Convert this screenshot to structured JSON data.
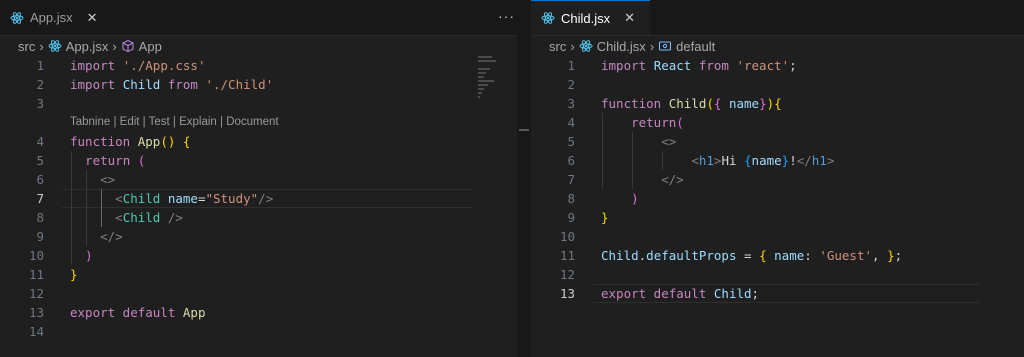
{
  "left_editor": {
    "tab": {
      "filename": "App.jsx",
      "icon": "react-icon",
      "close_icon": "close-icon"
    },
    "more_actions": "···",
    "breadcrumb": {
      "folder": "src",
      "file": "App.jsx",
      "symbol": "App"
    },
    "codelens": "Tabnine | Edit | Test | Explain | Document",
    "current_line": 7
  },
  "right_editor": {
    "tab": {
      "filename": "Child.jsx",
      "icon": "react-icon",
      "close_icon": "close-icon"
    },
    "breadcrumb": {
      "folder": "src",
      "file": "Child.jsx",
      "symbol": "default"
    },
    "current_line": 13
  },
  "left_code": [
    {
      "n": "1",
      "t": [
        [
          "kw",
          "import "
        ],
        [
          "str",
          "'./App.css'"
        ]
      ]
    },
    {
      "n": "2",
      "t": [
        [
          "kw",
          "import "
        ],
        [
          "var",
          "Child "
        ],
        [
          "kw",
          "from "
        ],
        [
          "str",
          "'./Child'"
        ]
      ]
    },
    {
      "n": "3",
      "t": []
    },
    {
      "n": "4",
      "t": [
        [
          "kw",
          "function "
        ],
        [
          "fn",
          "App"
        ],
        [
          "b1",
          "() {"
        ]
      ]
    },
    {
      "n": "5",
      "t": [
        [
          "plain",
          "  "
        ],
        [
          "kw",
          "return "
        ],
        [
          "b2",
          "("
        ]
      ]
    },
    {
      "n": "6",
      "t": [
        [
          "plain",
          "    "
        ],
        [
          "pun",
          "<>"
        ]
      ]
    },
    {
      "n": "7",
      "t": [
        [
          "plain",
          "      "
        ],
        [
          "pun",
          "<"
        ],
        [
          "cmp",
          "Child "
        ],
        [
          "var",
          "name"
        ],
        [
          "plain",
          "="
        ],
        [
          "str",
          "\"Study\""
        ],
        [
          "pun",
          "/>"
        ]
      ]
    },
    {
      "n": "8",
      "t": [
        [
          "plain",
          "      "
        ],
        [
          "pun",
          "<"
        ],
        [
          "cmp",
          "Child "
        ],
        [
          "pun",
          "/>"
        ]
      ]
    },
    {
      "n": "9",
      "t": [
        [
          "plain",
          "    "
        ],
        [
          "pun",
          "</>"
        ]
      ]
    },
    {
      "n": "10",
      "t": [
        [
          "plain",
          "  "
        ],
        [
          "b2",
          ")"
        ]
      ]
    },
    {
      "n": "11",
      "t": [
        [
          "b1",
          "}"
        ]
      ]
    },
    {
      "n": "12",
      "t": []
    },
    {
      "n": "13",
      "t": [
        [
          "kw",
          "export default "
        ],
        [
          "fn",
          "App"
        ]
      ]
    },
    {
      "n": "14",
      "t": []
    }
  ],
  "right_code": [
    {
      "n": "1",
      "t": [
        [
          "kw",
          "import "
        ],
        [
          "var",
          "React "
        ],
        [
          "kw",
          "from "
        ],
        [
          "str",
          "'react'"
        ],
        [
          "plain",
          ";"
        ]
      ]
    },
    {
      "n": "2",
      "t": []
    },
    {
      "n": "3",
      "t": [
        [
          "kw",
          "function "
        ],
        [
          "fn",
          "Child"
        ],
        [
          "b1",
          "("
        ],
        [
          "b2",
          "{ "
        ],
        [
          "var",
          "name"
        ],
        [
          "b2",
          "}"
        ],
        [
          "b1",
          "){"
        ]
      ]
    },
    {
      "n": "4",
      "t": [
        [
          "plain",
          "    "
        ],
        [
          "kw",
          "return"
        ],
        [
          "b2",
          "("
        ]
      ]
    },
    {
      "n": "5",
      "t": [
        [
          "plain",
          "        "
        ],
        [
          "pun",
          "<>"
        ]
      ]
    },
    {
      "n": "6",
      "t": [
        [
          "plain",
          "            "
        ],
        [
          "pun",
          "<"
        ],
        [
          "tag",
          "h1"
        ],
        [
          "pun",
          ">"
        ],
        [
          "plain",
          "Hi "
        ],
        [
          "b3",
          "{"
        ],
        [
          "var",
          "name"
        ],
        [
          "b3",
          "}"
        ],
        [
          "plain",
          "!"
        ],
        [
          "pun",
          "</"
        ],
        [
          "tag",
          "h1"
        ],
        [
          "pun",
          ">"
        ]
      ]
    },
    {
      "n": "7",
      "t": [
        [
          "plain",
          "        "
        ],
        [
          "pun",
          "</>"
        ]
      ]
    },
    {
      "n": "8",
      "t": [
        [
          "plain",
          "    "
        ],
        [
          "b2",
          ")"
        ]
      ]
    },
    {
      "n": "9",
      "t": [
        [
          "b1",
          "}"
        ]
      ]
    },
    {
      "n": "10",
      "t": []
    },
    {
      "n": "11",
      "t": [
        [
          "var",
          "Child"
        ],
        [
          "plain",
          "."
        ],
        [
          "var",
          "defaultProps "
        ],
        [
          "plain",
          "= "
        ],
        [
          "b1",
          "{ "
        ],
        [
          "var",
          "name"
        ],
        [
          "plain",
          ": "
        ],
        [
          "str",
          "'Guest'"
        ],
        [
          "plain",
          ", "
        ],
        [
          "b1",
          "}"
        ],
        [
          "plain",
          ";"
        ]
      ]
    },
    {
      "n": "12",
      "t": []
    },
    {
      "n": "13",
      "t": [
        [
          "kw",
          "export default "
        ],
        [
          "var",
          "Child"
        ],
        [
          "plain",
          ";"
        ]
      ]
    }
  ]
}
